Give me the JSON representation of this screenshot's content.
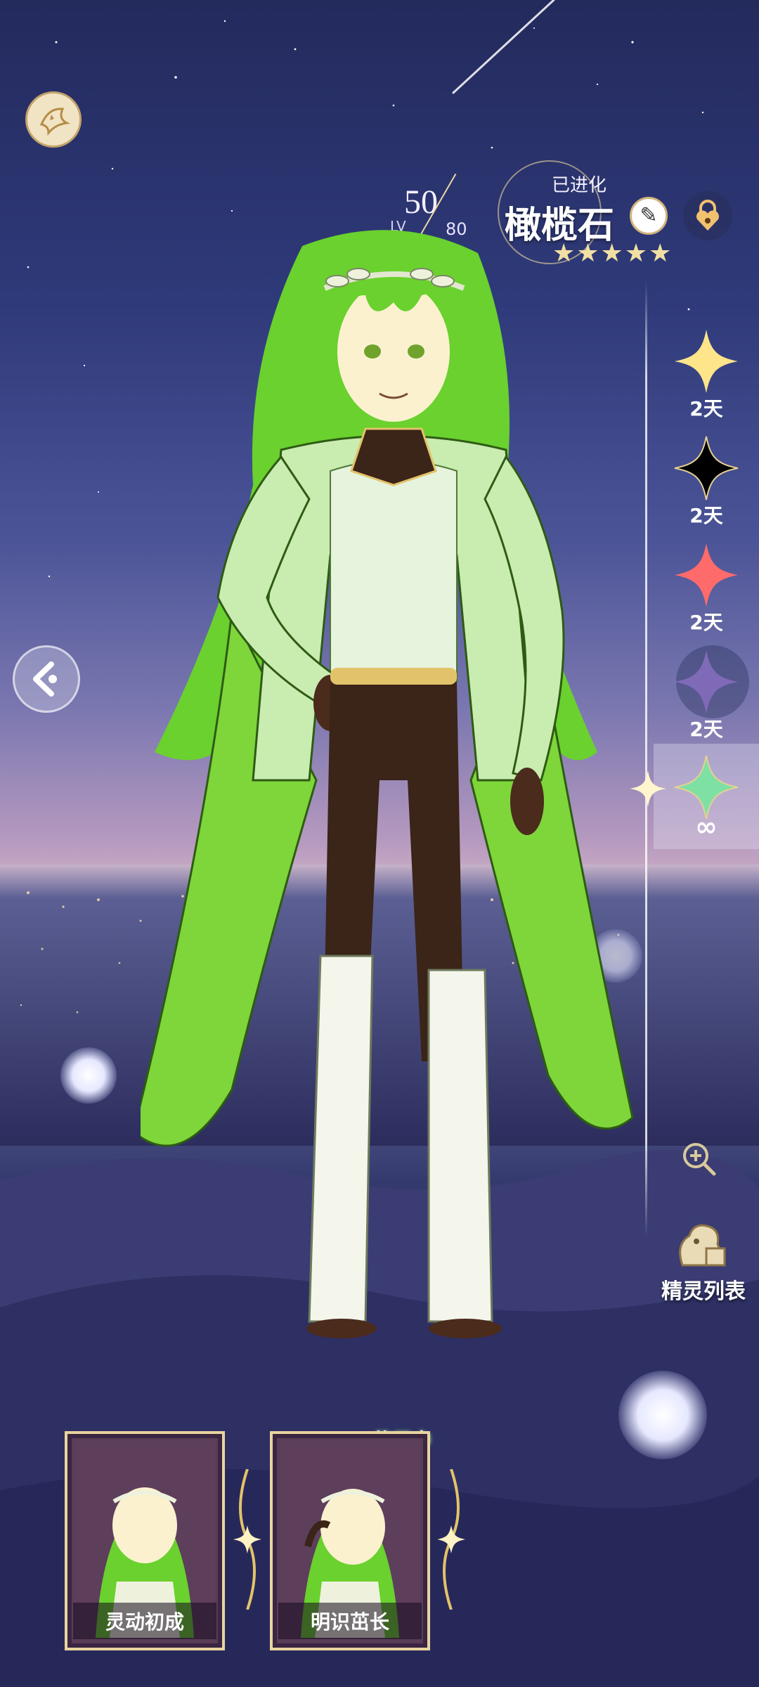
{
  "header": {
    "back_icon": "fairy-wing-emblem-icon",
    "level": {
      "current": "50",
      "prefix": "LV",
      "max": "80"
    },
    "status": "已进化",
    "pet_name": "橄榄石",
    "rating_stars": "★★★★★",
    "rating": 5,
    "edit_icon": "pencil-icon",
    "lock_icon": "heart-lock-icon"
  },
  "rail": {
    "items": [
      {
        "color": "#ffe58a",
        "duration": "2天",
        "icon": "four-point-star-icon"
      },
      {
        "color": "#000000",
        "duration": "2天",
        "icon": "four-point-star-icon"
      },
      {
        "color": "#ff6b6b",
        "duration": "2天",
        "icon": "four-point-star-icon"
      },
      {
        "color": "#b48ef0",
        "duration": "2天",
        "icon": "four-point-star-icon"
      },
      {
        "color": "#7fe0a4",
        "duration": "∞",
        "icon": "four-point-star-icon",
        "selected": true
      }
    ]
  },
  "tools": {
    "zoom_icon": "zoom-in-icon",
    "list_label": "精灵列表"
  },
  "nav": {
    "prev_icon": "chevron-left-icon"
  },
  "skins": [
    {
      "name": "灵动初成"
    },
    {
      "name": "明识茁长",
      "badge": "使用中"
    }
  ],
  "colors": {
    "accent_gold": "#e9d4a0",
    "hair_green": "#76d63c"
  }
}
